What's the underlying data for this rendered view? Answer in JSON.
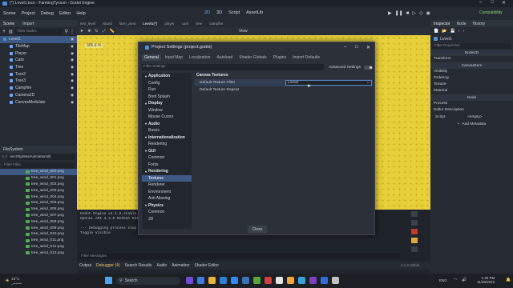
{
  "window": {
    "title": "(*) Level1.tscn - FarmingTycoon - Godot Engine"
  },
  "menubar": {
    "items": [
      "Scene",
      "Project",
      "Debug",
      "Editor",
      "Help"
    ],
    "workspaces": [
      "2D",
      "3D",
      "Script",
      "AssetLib"
    ],
    "renderer": "Compatibility"
  },
  "scene_dock": {
    "tabs": [
      "Scene",
      "Import"
    ],
    "filter_placeholder": "Filter Nodes",
    "nodes": [
      "Level1",
      "TileMap",
      "Player",
      "Carb",
      "Tree",
      "Tree2",
      "Tree3",
      "Campfire",
      "Camera2D",
      "CanvasModulate"
    ]
  },
  "filesystem_dock": {
    "title": "FileSystem",
    "path": "res://Sprites/Animations/tr",
    "filter_placeholder": "Filter Files",
    "files": [
      "tree_wind_000.png",
      "tree_wind_001.png",
      "tree_wind_002.png",
      "tree_wind_003.png",
      "tree_wind_004.png",
      "tree_wind_005.png",
      "tree_wind_006.png",
      "tree_wind_007.png",
      "tree_wind_008.png",
      "tree_wind_009.png",
      "tree_wind_010.png",
      "tree_wind_011.png",
      "tree_wind_012.png",
      "tree_wind_013.png"
    ]
  },
  "editor_tabs": [
    "test_level",
    "island",
    "farm_area",
    "Level1(*)",
    "player",
    "carb",
    "tree",
    "campfire"
  ],
  "viewport": {
    "zoom": "305.6 %",
    "view_label": "View"
  },
  "dialog": {
    "title": "Project Settings (project.godot)",
    "tabs": [
      "General",
      "Input Map",
      "Localization",
      "Autoload",
      "Shader Globals",
      "Plugins",
      "Import Defaults"
    ],
    "filter_placeholder": "Filter Settings",
    "advanced_label": "Advanced Settings",
    "categories": [
      {
        "label": "Application",
        "section": true
      },
      {
        "label": "Config"
      },
      {
        "label": "Run"
      },
      {
        "label": "Boot Splash"
      },
      {
        "label": "Display",
        "section": true
      },
      {
        "label": "Window"
      },
      {
        "label": "Mouse Cursor"
      },
      {
        "label": "Audio",
        "section": true
      },
      {
        "label": "Buses"
      },
      {
        "label": "Internationalization",
        "section": true
      },
      {
        "label": "Rendering"
      },
      {
        "label": "GUI",
        "section": true
      },
      {
        "label": "Common"
      },
      {
        "label": "Fonts"
      },
      {
        "label": "Rendering",
        "section": true
      },
      {
        "label": "Textures",
        "selected": true
      },
      {
        "label": "Renderer"
      },
      {
        "label": "Environment"
      },
      {
        "label": "Anti Aliasing"
      },
      {
        "label": "Physics",
        "section": true
      },
      {
        "label": "Common"
      },
      {
        "label": "2D"
      }
    ],
    "section_title": "Canvas Textures",
    "settings": [
      {
        "label": "Default Texture Filter",
        "value": "Linear"
      },
      {
        "label": "Default Texture Repeat",
        "value": ""
      }
    ],
    "close_label": "Close"
  },
  "console": {
    "lines": [
      "Godot Engine v4.1.2.stable.",
      "OpenGL API 3.3.0 NVIDIA 531",
      "",
      "--- Debugging process stop",
      "Toggle Visible"
    ],
    "filter_placeholder": "Filter Messages"
  },
  "bottom_tabs": [
    "Output",
    "Debugger (4)",
    "Search Results",
    "Audio",
    "Animation",
    "Shader Editor"
  ],
  "version": "4.1.2.stable",
  "inspector": {
    "tabs": [
      "Inspector",
      "Node",
      "History"
    ],
    "node_name": "Level1",
    "filter_placeholder": "Filter Properties",
    "sections": [
      "Transform",
      "Visibility",
      "Ordering",
      "Texture",
      "Material",
      "Process",
      "Editor Description"
    ],
    "class_labels": [
      "Node2D",
      "CanvasItem",
      "Node"
    ],
    "script_label": "Script",
    "script_value": "<empty>",
    "add_metadata": "Add Metadata"
  },
  "taskbar": {
    "weather_temp": "22°C",
    "weather_desc": "مشمس",
    "search_placeholder": "Search",
    "lang": "ENG",
    "time": "1:30 PM",
    "date": "11/29/2023"
  },
  "colors": {
    "accent": "#3e5a84",
    "viewport_yellow": "#e6cf3a",
    "panel": "#262b33"
  }
}
